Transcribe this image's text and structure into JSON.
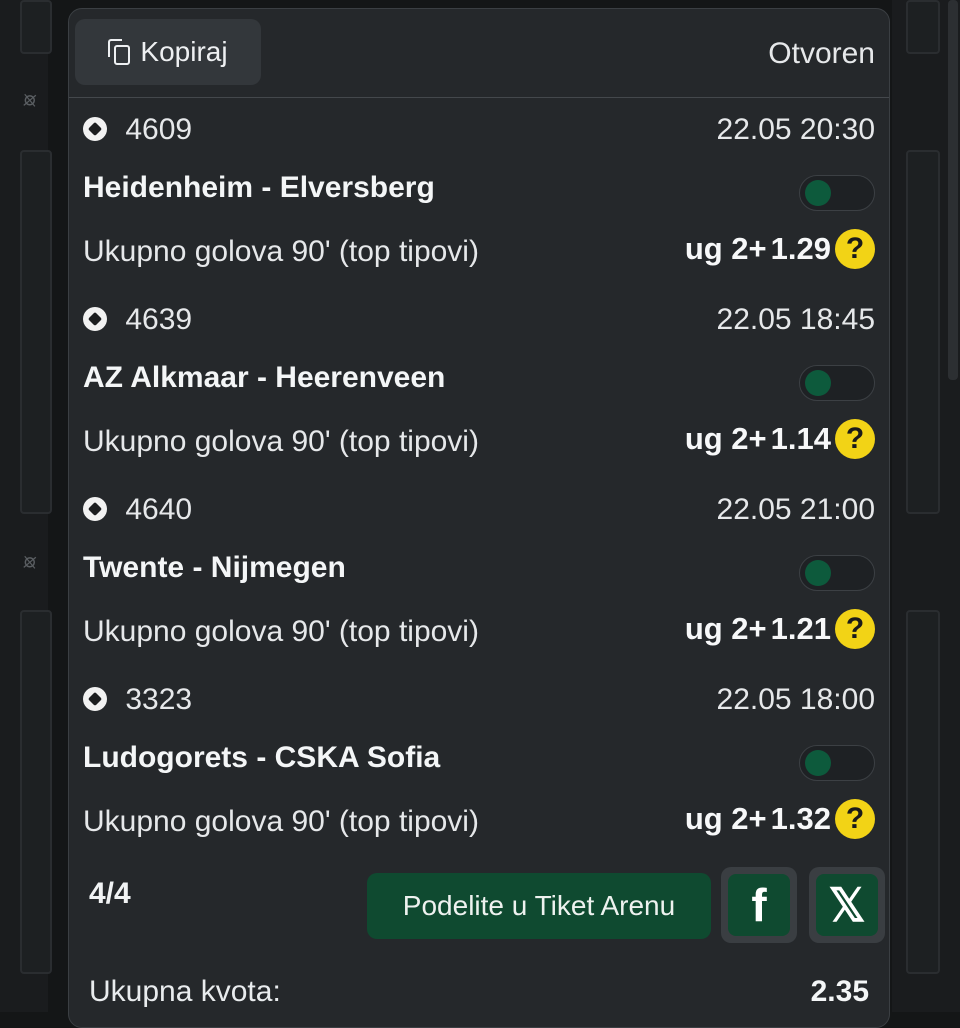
{
  "header": {
    "copy_label": "Kopiraj",
    "status": "Otvoren"
  },
  "matches": [
    {
      "code": "4609",
      "datetime": "22.05 20:30",
      "teams": "Heidenheim - Elversberg",
      "market": "Ukupno golova 90' (top tipovi)",
      "pick": "ug 2+",
      "odds": "1.29"
    },
    {
      "code": "4639",
      "datetime": "22.05 18:45",
      "teams": "AZ Alkmaar - Heerenveen",
      "market": "Ukupno golova 90' (top tipovi)",
      "pick": "ug 2+",
      "odds": "1.14"
    },
    {
      "code": "4640",
      "datetime": "22.05 21:00",
      "teams": "Twente - Nijmegen",
      "market": "Ukupno golova 90' (top tipovi)",
      "pick": "ug 2+",
      "odds": "1.21"
    },
    {
      "code": "3323",
      "datetime": "22.05 18:00",
      "teams": "Ludogorets - CSKA Sofia",
      "market": "Ukupno golova 90' (top tipovi)",
      "pick": "ug 2+",
      "odds": "1.32"
    }
  ],
  "footer": {
    "counter": "4/4",
    "share_label": "Podelite u Tiket Arenu",
    "facebook_glyph": "f",
    "x_glyph": "𝕏",
    "total_label": "Ukupna kvota:",
    "total_value": "2.35"
  },
  "icons": {
    "help": "?"
  },
  "colors": {
    "accent_green": "#0f4a30",
    "help_yellow": "#f2d316",
    "panel": "#25282b"
  }
}
